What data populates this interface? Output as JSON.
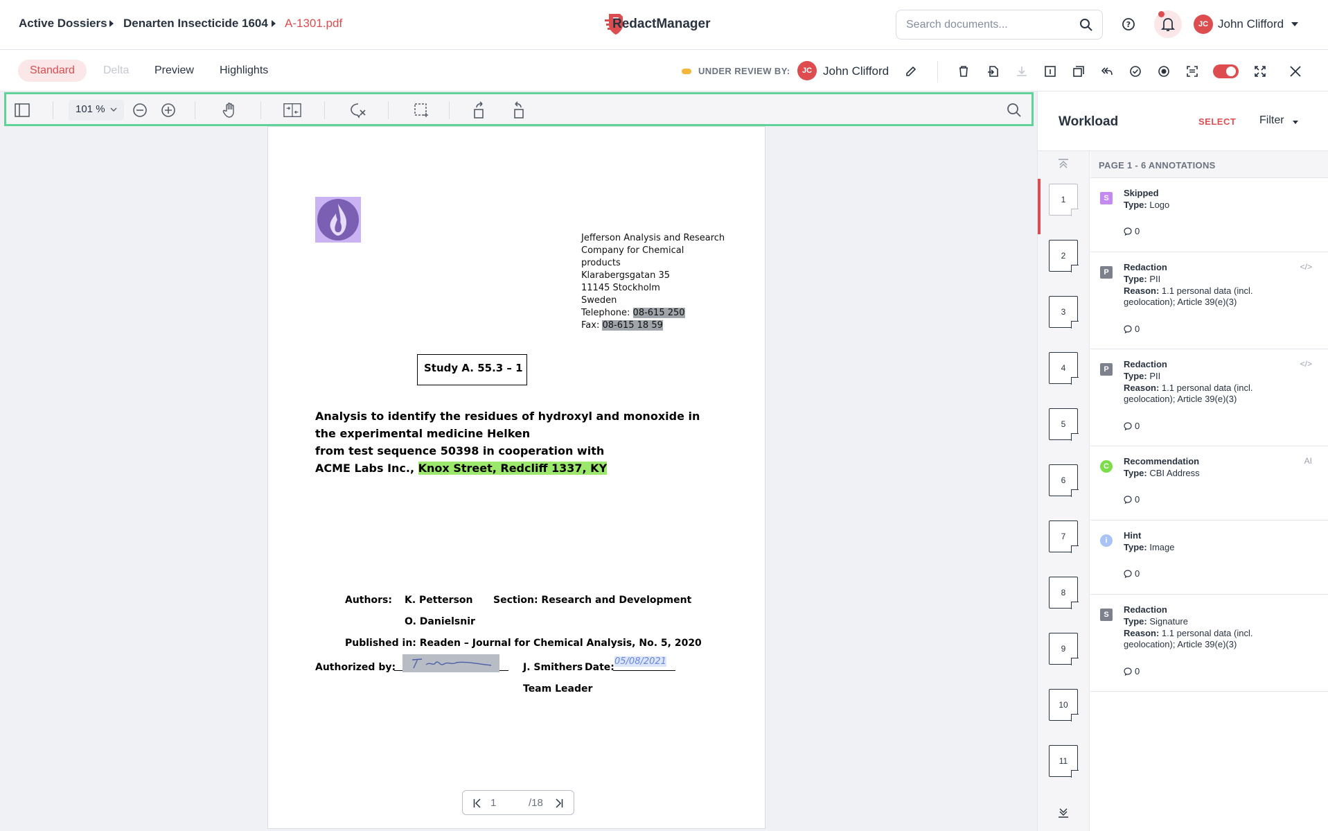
{
  "breadcrumb": {
    "item1": "Active Dossiers",
    "item2": "Denarten Insecticide 1604",
    "item3": "A-1301.pdf"
  },
  "app": {
    "name": "RedactManager"
  },
  "search": {
    "placeholder": "Search documents..."
  },
  "user": {
    "initials": "JC",
    "name": "John Clifford"
  },
  "view_tabs": [
    "Standard",
    "Delta",
    "Preview",
    "Highlights"
  ],
  "review": {
    "label": "UNDER REVIEW BY:",
    "initials": "JC",
    "name": "John Clifford"
  },
  "toolbar": {
    "zoom": "101 %"
  },
  "document": {
    "address": [
      "Jefferson Analysis and Research",
      "Company for Chemical",
      "products",
      "Klarabergsgatan 35",
      "11145 Stockholm",
      "Sweden"
    ],
    "telephone_label": "Telephone: ",
    "telephone": "08-615 250",
    "fax_label": "Fax: ",
    "fax": "08-615 18 59",
    "study": "Study A. 55.3 – 1",
    "title_lines": [
      "Analysis to identify the residues of hydroxyl and monoxide in",
      "the experimental medicine Helken",
      "from test sequence 50398 in cooperation with"
    ],
    "title_last_prefix": "ACME Labs Inc., ",
    "title_last_highlight": "Knox Street, Redcliff 1337, KY",
    "authors_label": "Authors:",
    "author1": "K. Petterson",
    "author2": "O. Danielsnir",
    "section": "Section: Research and Development",
    "published": "Published in: Readen – Journal for Chemical Analysis, No. 5, 2020",
    "authorized_label": "Authorized by:",
    "signer": "J. Smithers",
    "date_label": "Date:",
    "date_value": "05/08/2021",
    "role": "Team Leader"
  },
  "pager": {
    "current": "1",
    "total": "/18"
  },
  "panel": {
    "title": "Workload",
    "select": "SELECT",
    "filter": "Filter",
    "annotations_header": "PAGE 1 - 6 ANNOTATIONS",
    "pages": [
      "1",
      "2",
      "3",
      "4",
      "5",
      "6",
      "7",
      "8",
      "9",
      "10",
      "11"
    ],
    "annotations": [
      {
        "badge": "S",
        "color": "#c48af0",
        "title": "Skipped",
        "type_label": "Type:",
        "type": "Logo",
        "comments": "0"
      },
      {
        "badge": "P",
        "color": "#7c818b",
        "title": "Redaction",
        "type_label": "Type:",
        "type": "PII",
        "reason_label": "Reason:",
        "reason": "1.1 personal data (incl. geolocation); Article 39(e)(3)",
        "comments": "0"
      },
      {
        "badge": "P",
        "color": "#7c818b",
        "title": "Redaction",
        "type_label": "Type:",
        "type": "PII",
        "reason_label": "Reason:",
        "reason": "1.1 personal data (incl. geolocation); Article 39(e)(3)",
        "comments": "0"
      },
      {
        "badge": "C",
        "color": "#7ddc4a",
        "title": "Recommendation",
        "type_label": "Type:",
        "type": "CBI Address",
        "side": "AI",
        "comments": "0"
      },
      {
        "badge": "i",
        "color": "#a9c3f5",
        "title": "Hint",
        "type_label": "Type:",
        "type": "Image",
        "comments": "0"
      },
      {
        "badge": "S",
        "color": "#7c818b",
        "title": "Redaction",
        "type_label": "Type:",
        "type": "Signature",
        "reason_label": "Reason:",
        "reason": "1.1 personal data (incl. geolocation); Article 39(e)(3)",
        "comments": "0"
      }
    ]
  },
  "colors": {
    "accent": "#dd4d50",
    "toolbar_highlight": "#5fd39a",
    "review_dot": "#f5b63c"
  }
}
